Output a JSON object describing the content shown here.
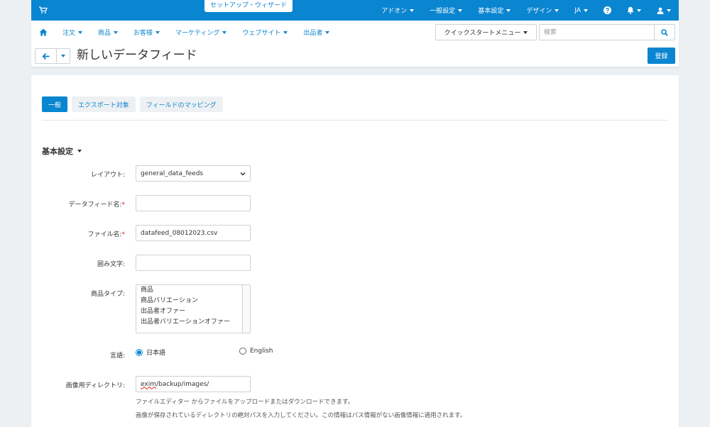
{
  "topbar": {
    "wizard": "セットアップ・ウィザード",
    "items": [
      {
        "label": "アドオン"
      },
      {
        "label": "一般設定"
      },
      {
        "label": "基本設定"
      },
      {
        "label": "デザイン"
      },
      {
        "label": "JA"
      }
    ]
  },
  "mainnav": {
    "items": [
      {
        "label": "注文"
      },
      {
        "label": "商品"
      },
      {
        "label": "お客様"
      },
      {
        "label": "マーケティング"
      },
      {
        "label": "ウェブサイト"
      },
      {
        "label": "出品者"
      }
    ],
    "quickstart": "クイックスタートメニュー",
    "search_placeholder": "検索"
  },
  "page": {
    "title": "新しいデータフィード",
    "save_label": "登録"
  },
  "tabs": [
    {
      "label": "一般",
      "active": true
    },
    {
      "label": "エクスポート対象",
      "active": false
    },
    {
      "label": "フィールドのマッピング",
      "active": false
    }
  ],
  "form": {
    "section_title": "基本設定",
    "layout": {
      "label": "レイアウト:",
      "value": "general_data_feeds"
    },
    "feed_name": {
      "label": "データフィード名:",
      "required": "*",
      "value": ""
    },
    "file_name": {
      "label": "ファイル名:",
      "required": "*",
      "value": "datafeed_08012023.csv"
    },
    "enclosure": {
      "label": "囲み文字:",
      "value": ""
    },
    "product_type": {
      "label": "商品タイプ:",
      "options": [
        "商品",
        "商品バリエーション",
        "出品者オファー",
        "出品者バリエーションオファー"
      ]
    },
    "language": {
      "label": "言語:",
      "options": [
        {
          "label": "日本語",
          "selected": true
        },
        {
          "label": "English",
          "selected": false
        }
      ]
    },
    "image_dir": {
      "label": "画像用ディレクトリ:",
      "value_prefix": "exim",
      "value_rest": "/backup/images/",
      "help1": "ファイルエディター からファイルをアップロードまたはダウンロードできます。",
      "help2": "画像が保存されているディレクトリの絶対パスを入力してください。この情報はパス情報がない画像情報に適用されます。"
    }
  },
  "colors": {
    "primary": "#0a85d0",
    "required": "#e02020"
  }
}
